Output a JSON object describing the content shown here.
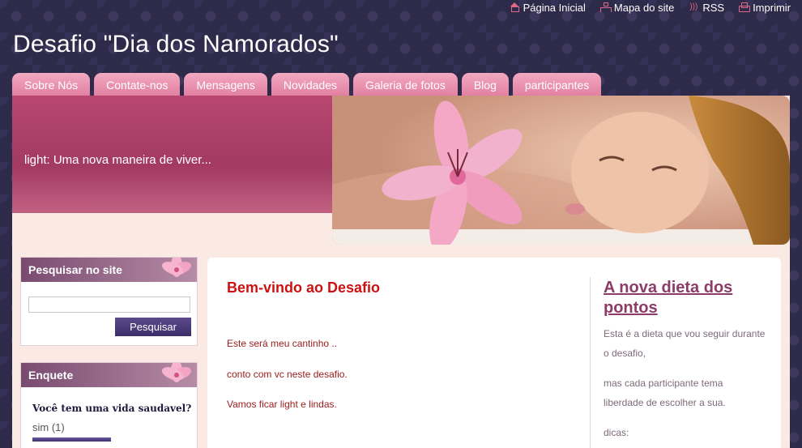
{
  "top_links": [
    {
      "label": "Página Inicial",
      "icon": "home-icon"
    },
    {
      "label": "Mapa do site",
      "icon": "sitemap-icon"
    },
    {
      "label": "RSS",
      "icon": "rss-icon"
    },
    {
      "label": "Imprimir",
      "icon": "print-icon"
    }
  ],
  "site_title": "Desafio \"Dia dos Namorados\"",
  "nav_tabs": [
    "Sobre Nós",
    "Contate-nos",
    "Mensagens",
    "Novidades",
    "Galeria de fotos",
    "Blog",
    "participantes"
  ],
  "banner": {
    "text": "light: Uma nova maneira de viver..."
  },
  "search_box": {
    "title": "Pesquisar no site",
    "input_value": "",
    "button_label": "Pesquisar"
  },
  "poll": {
    "title": "Enquete",
    "question": "Você tem uma vida saudavel?",
    "option": "sim (1)",
    "option_fraction": 1.0
  },
  "main": {
    "heading": "Bem-vindo ao Desafio",
    "lines": [
      "Este será meu cantinho ..",
      "conto com vc  neste desafio.",
      "Vamos ficar light e lindas."
    ]
  },
  "right_column": {
    "title": "A nova dieta dos pontos",
    "paragraphs": [
      "Esta é a dieta que vou seguir durante o desafio,",
      "mas cada participante tema liberdade de escolher a sua.",
      "dicas:"
    ]
  },
  "colors": {
    "accent_pink": "#e27fa1",
    "heading_red": "#cc1212",
    "link_purple": "#8c3c68",
    "page_bg": "#2e2a4a"
  }
}
